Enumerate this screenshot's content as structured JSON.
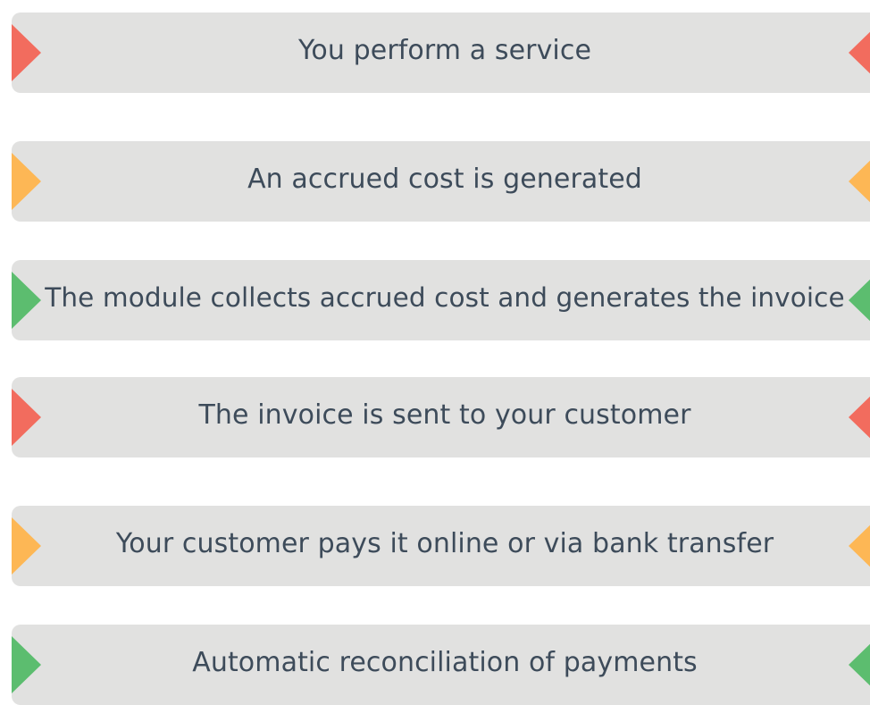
{
  "colors": {
    "red": "#f26c5e",
    "orange": "#fdb755",
    "green": "#5cbd6f",
    "bar": "#e1e1e0",
    "text": "#3d4b5a"
  },
  "steps": [
    {
      "label": "You perform a service",
      "marker_color": "#f26c5e"
    },
    {
      "label": "An accrued cost is generated",
      "marker_color": "#fdb755"
    },
    {
      "label": "The module collects accrued cost and generates the invoice",
      "marker_color": "#5cbd6f"
    },
    {
      "label": "The invoice is sent to your customer",
      "marker_color": "#f26c5e"
    },
    {
      "label": "Your customer pays it online or via bank transfer",
      "marker_color": "#fdb755"
    },
    {
      "label": "Automatic reconciliation of payments",
      "marker_color": "#5cbd6f"
    }
  ]
}
